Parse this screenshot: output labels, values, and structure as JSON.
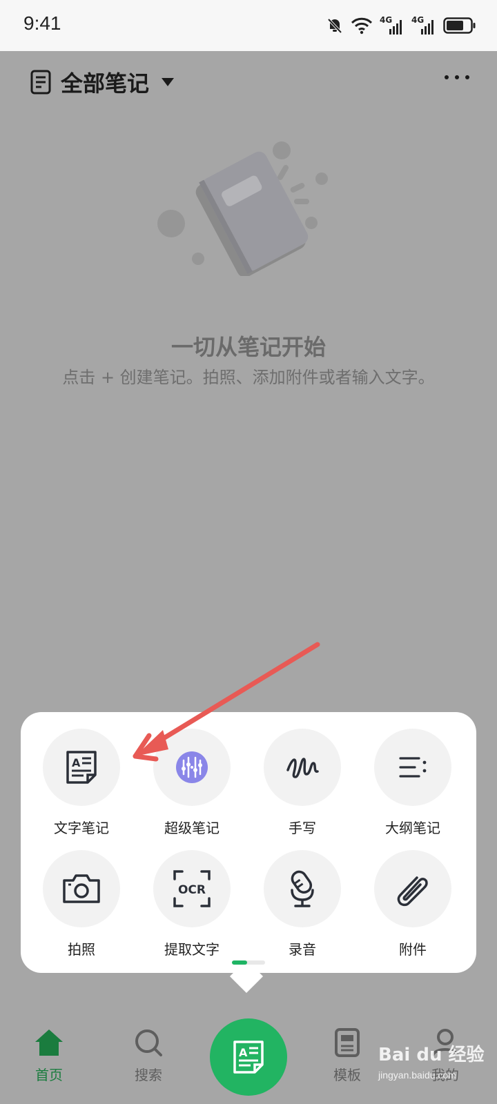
{
  "status_bar": {
    "time": "9:41",
    "network_1": "4G",
    "network_2": "4G"
  },
  "header": {
    "title": "全部笔记",
    "note_icon": "notebook-icon",
    "more_icon": "more-dots-icon"
  },
  "empty_state": {
    "title": "一切从笔记开始",
    "description": "点击 + 创建笔记。拍照、添加附件或者输入文字。"
  },
  "create_menu": {
    "items": [
      {
        "label": "文字笔记",
        "icon": "text-note-icon"
      },
      {
        "label": "超级笔记",
        "icon": "super-note-icon"
      },
      {
        "label": "手写",
        "icon": "handwriting-icon"
      },
      {
        "label": "大纲笔记",
        "icon": "outline-icon"
      },
      {
        "label": "拍照",
        "icon": "camera-icon"
      },
      {
        "label": "提取文字",
        "icon": "ocr-icon",
        "icon_text": "OCR"
      },
      {
        "label": "录音",
        "icon": "microphone-icon"
      },
      {
        "label": "附件",
        "icon": "paperclip-icon"
      }
    ]
  },
  "bottom_nav": {
    "items": [
      {
        "label": "首页",
        "icon": "home-icon"
      },
      {
        "label": "搜索",
        "icon": "search-icon"
      },
      {
        "label": "模板",
        "icon": "template-icon"
      },
      {
        "label": "我的",
        "icon": "profile-icon"
      }
    ]
  },
  "watermark": {
    "brand": "Bai du 经验",
    "url": "jingyan.baidu.com"
  },
  "colors": {
    "accent": "#22b462",
    "active_nav": "#1a7c3e",
    "annotation_arrow": "#e85a55"
  }
}
